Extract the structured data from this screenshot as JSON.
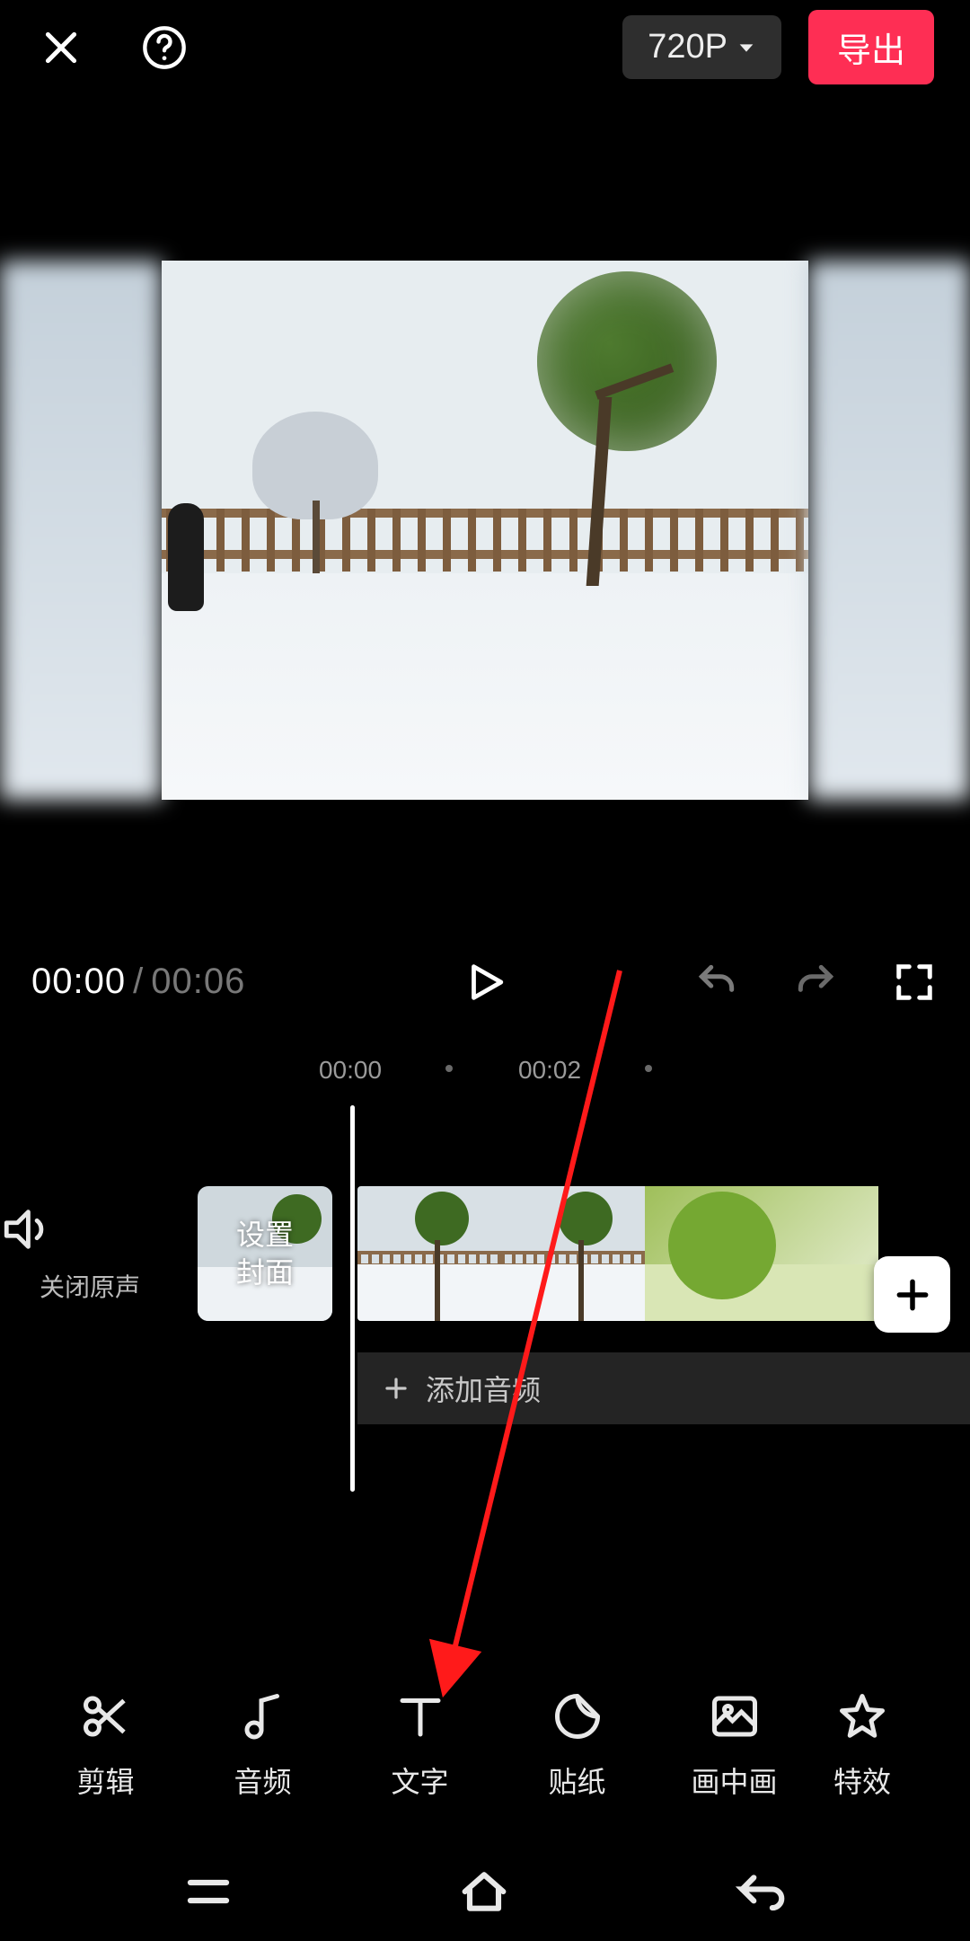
{
  "header": {
    "resolution_label": "720P",
    "export_label": "导出"
  },
  "playback": {
    "current_time": "00:00",
    "duration": "00:06"
  },
  "ruler_ticks": [
    "00:00",
    "00:02"
  ],
  "mute": {
    "label": "关闭原声"
  },
  "cover_button": {
    "label_line1": "设置",
    "label_line2": "封面"
  },
  "audio_track": {
    "add_label": "添加音频"
  },
  "tools": [
    {
      "id": "edit",
      "label": "剪辑"
    },
    {
      "id": "audio",
      "label": "音频"
    },
    {
      "id": "text",
      "label": "文字"
    },
    {
      "id": "sticker",
      "label": "贴纸"
    },
    {
      "id": "pip",
      "label": "画中画"
    },
    {
      "id": "effects",
      "label": "特效"
    }
  ],
  "colors": {
    "accent": "#fe2e54"
  }
}
